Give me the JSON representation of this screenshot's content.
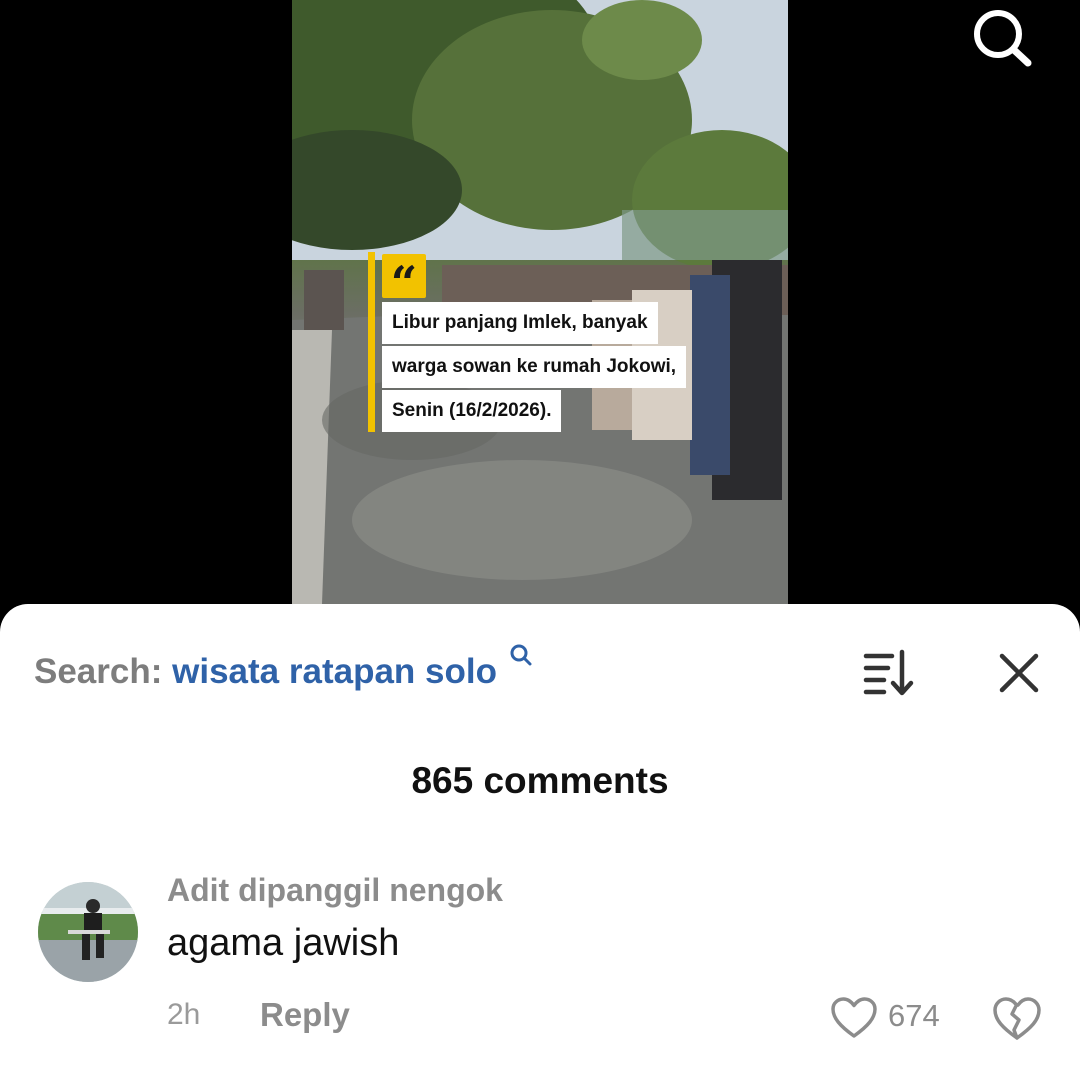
{
  "video": {
    "caption_lines": [
      "Libur panjang Imlek, banyak",
      "warga sowan ke rumah Jokowi,",
      "Senin (16/2/2026)."
    ],
    "quote_glyph": "“"
  },
  "top_bar": {
    "search_icon": "search-icon"
  },
  "comments_panel": {
    "search_label": "Search:",
    "search_query": "wisata ratapan solo",
    "count_text": "865 comments",
    "icons": {
      "sort": "sort-icon",
      "close": "close-icon"
    }
  },
  "comments": [
    {
      "author": "Adit dipanggil nengok",
      "text": "agama jawish",
      "time": "2h",
      "reply_label": "Reply",
      "likes": "674"
    }
  ],
  "colors": {
    "accent_blue": "#2f62a8",
    "caption_yellow": "#f2c200",
    "muted_gray": "#8c8c8c"
  }
}
